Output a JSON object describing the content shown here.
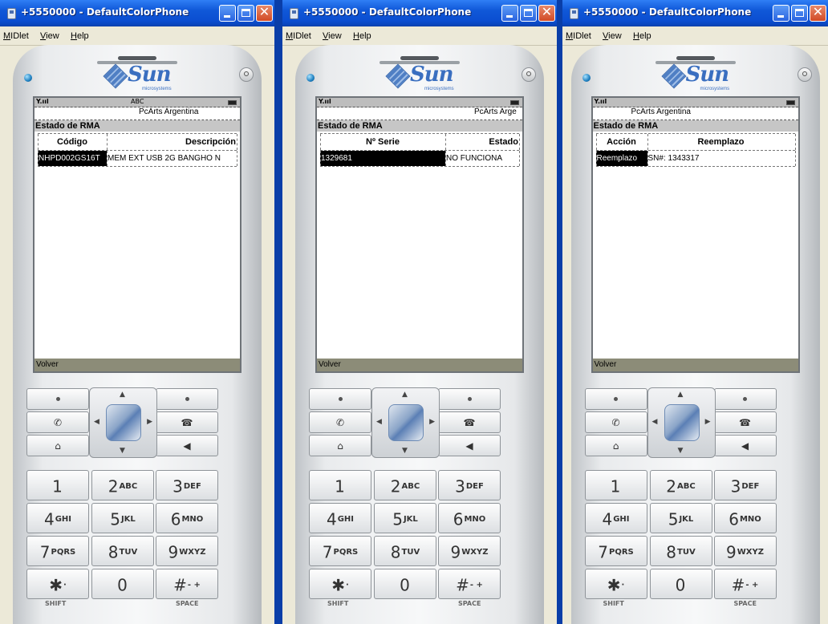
{
  "windows": [
    {
      "title": "+5550000 - DefaultColorPhone",
      "menu": [
        "MIDlet",
        "View",
        "Help"
      ],
      "screen": {
        "signal": "Y.ııl",
        "input_mode": "ABC",
        "ticker": "PcArts Argentina",
        "form_title": "Estado de RMA",
        "columns": [
          "Código",
          "Descripción"
        ],
        "rows": [
          [
            "NHPD002GS16T",
            "MEM EXT USB 2G BANGHO N"
          ]
        ],
        "softkey": "Volver"
      }
    },
    {
      "title": "+5550000 - DefaultColorPhone",
      "menu": [
        "MIDlet",
        "View",
        "Help"
      ],
      "screen": {
        "signal": "Y.ııl",
        "input_mode": "",
        "ticker": "PcArts Arge",
        "form_title": "Estado de RMA",
        "columns": [
          "Nº Serie",
          "Estado"
        ],
        "rows": [
          [
            "1329681",
            "NO FUNCIONA"
          ]
        ],
        "softkey": "Volver"
      }
    },
    {
      "title": "+5550000 - DefaultColorPhone",
      "menu": [
        "MIDlet",
        "View",
        "Help"
      ],
      "screen": {
        "signal": "Y.ııl",
        "input_mode": "",
        "ticker": "PcArts Argentina",
        "form_title": "Estado de RMA",
        "columns": [
          "Acción",
          "Reemplazo"
        ],
        "rows": [
          [
            "Reemplazo",
            "SN#: 1343317"
          ]
        ],
        "softkey": "Volver"
      }
    }
  ],
  "phone": {
    "brand": "Sun",
    "brand_sub": "microsystems",
    "keys": [
      {
        "num": "1",
        "letters": ""
      },
      {
        "num": "2",
        "letters": "ABC"
      },
      {
        "num": "3",
        "letters": "DEF"
      },
      {
        "num": "4",
        "letters": "GHI"
      },
      {
        "num": "5",
        "letters": "JKL"
      },
      {
        "num": "6",
        "letters": "MNO"
      },
      {
        "num": "7",
        "letters": "PQRS"
      },
      {
        "num": "8",
        "letters": "TUV"
      },
      {
        "num": "9",
        "letters": "WXYZ"
      },
      {
        "num": "✱",
        "letters": "·"
      },
      {
        "num": "0",
        "letters": ""
      },
      {
        "num": "#",
        "letters": "- +"
      }
    ],
    "shift_label": "SHIFT",
    "space_label": "SPACE",
    "icons": {
      "dot": "•",
      "call": "✆",
      "end": "☎",
      "home": "⌂",
      "back": "◀"
    }
  },
  "titlebar_buttons": {
    "close_glyph": "✕"
  }
}
